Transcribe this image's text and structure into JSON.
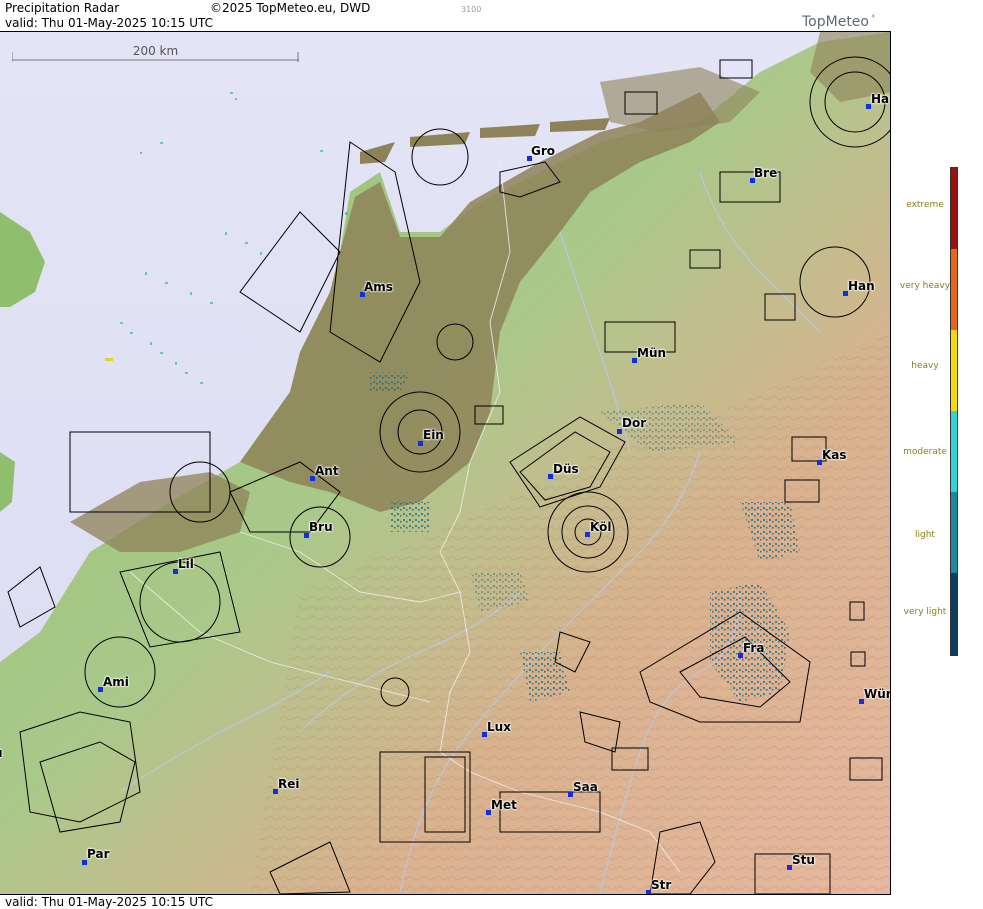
{
  "header": {
    "title": "Precipitation Radar",
    "copyright": "©2025 TopMeteo.eu, DWD",
    "valid": "valid:  Thu  01-May-2025 10:15 UTC",
    "code": "3100",
    "logo": "TopMeteo"
  },
  "footer": {
    "valid": "valid:  Thu  01-May-2025 10:15 UTC"
  },
  "scale_bar": {
    "label": "200 km"
  },
  "legend": {
    "items": [
      {
        "label": "extreme",
        "color": "#9e1010"
      },
      {
        "label": "very heavy",
        "color": "#e8661c"
      },
      {
        "label": "heavy",
        "color": "#f5d80e"
      },
      {
        "label": "moderate",
        "color": "#2fd4d4"
      },
      {
        "label": "light",
        "color": "#1c8a9c"
      },
      {
        "label": "very light",
        "color": "#0f3f5e"
      }
    ]
  },
  "cities": [
    {
      "name": "Gro"
    },
    {
      "name": "Bre"
    },
    {
      "name": "Ha"
    },
    {
      "name": "Ams"
    },
    {
      "name": "Han"
    },
    {
      "name": "Mün"
    },
    {
      "name": "Dor"
    },
    {
      "name": "Ein"
    },
    {
      "name": "Kas"
    },
    {
      "name": "Ant"
    },
    {
      "name": "Düs"
    },
    {
      "name": "Bru"
    },
    {
      "name": "Köl"
    },
    {
      "name": "Lil"
    },
    {
      "name": "Fra"
    },
    {
      "name": "Ami"
    },
    {
      "name": "Wür"
    },
    {
      "name": "Lux"
    },
    {
      "name": "Rei"
    },
    {
      "name": "Saa"
    },
    {
      "name": "Met"
    },
    {
      "name": "Par"
    },
    {
      "name": "Stu"
    },
    {
      "name": "Str"
    },
    {
      "name": "u"
    }
  ]
}
